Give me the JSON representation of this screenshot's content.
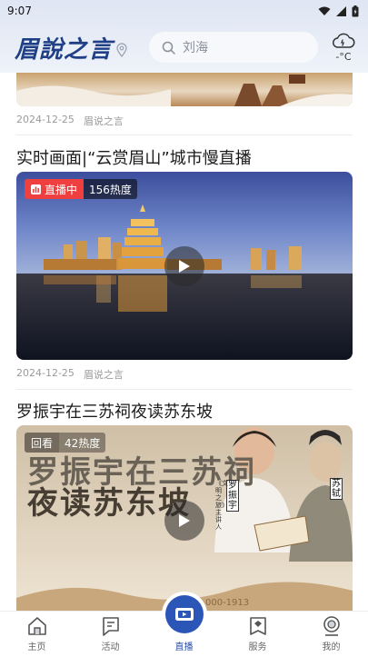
{
  "status_bar": {
    "time": "9:07"
  },
  "header": {
    "logo_text": "眉說之言",
    "search_placeholder": "刘海",
    "weather_temp": "-°C"
  },
  "articles": [
    {
      "date": "2024-12-25",
      "source": "眉说之言"
    },
    {
      "title": "实时画面|“云赏眉山”城市慢直播",
      "badge_status": "直播中",
      "badge_heat": "156热度",
      "date": "2024-12-25",
      "source": "眉说之言"
    },
    {
      "title": "罗振宇在三苏祠夜读苏东坡",
      "badge_status": "回看",
      "badge_heat": "42热度",
      "overlay_line1": "罗振宇在三苏祠",
      "overlay_line2": "夜读苏东坡",
      "host_name": "罗振宇",
      "host_show": "《文明之旅》主讲人",
      "figure_name": "苏轼",
      "hotline": "000-1913"
    }
  ],
  "tabbar": {
    "items": [
      {
        "label": "主页",
        "icon": "home-icon"
      },
      {
        "label": "活动",
        "icon": "flag-icon"
      },
      {
        "label": "直播",
        "icon": "video-icon"
      },
      {
        "label": "服务",
        "icon": "bookmark-icon"
      },
      {
        "label": "我的",
        "icon": "profile-icon"
      }
    ]
  }
}
